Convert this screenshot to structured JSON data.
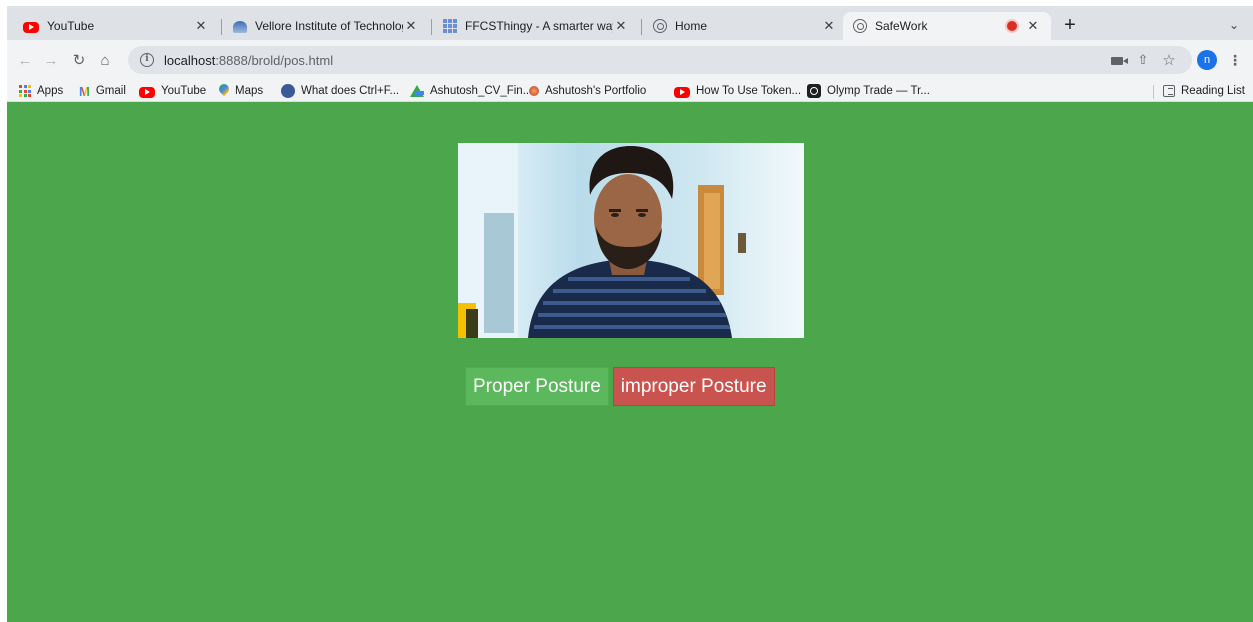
{
  "tabs": [
    {
      "title": "YouTube",
      "favicon": "youtube-icon"
    },
    {
      "title": "Vellore Institute of Technology",
      "favicon": "vit-icon"
    },
    {
      "title": "FFCSThingy - A smarter way to",
      "favicon": "ffcs-grid-icon"
    },
    {
      "title": "Home",
      "favicon": "globe-icon"
    },
    {
      "title": "SafeWork",
      "favicon": "globe-icon",
      "active": true,
      "recording": true
    }
  ],
  "toolbar": {
    "url_host": "localhost",
    "url_path": ":8888/brold/pos.html",
    "profile_initial": "n"
  },
  "bookmarks": [
    {
      "label": "Apps",
      "icon": "apps-grid-icon"
    },
    {
      "label": "Gmail",
      "icon": "gmail-icon"
    },
    {
      "label": "YouTube",
      "icon": "youtube-icon"
    },
    {
      "label": "Maps",
      "icon": "maps-pin-icon"
    },
    {
      "label": "What does Ctrl+F...",
      "icon": "blue-circle-icon"
    },
    {
      "label": "Ashutosh_CV_Fin...",
      "icon": "google-drive-icon"
    },
    {
      "label": "Ashutosh's Portfolio",
      "icon": "portfolio-icon"
    },
    {
      "label": "How To Use Token...",
      "icon": "youtube-icon"
    },
    {
      "label": "Olymp Trade — Tr...",
      "icon": "olymp-trade-icon"
    }
  ],
  "reading_list": "Reading List",
  "page": {
    "background": "#4ca64c",
    "proper_button": "Proper Posture",
    "improper_button": "improper Posture",
    "proper_color": "#5cb85c",
    "improper_color": "#c9534f"
  }
}
